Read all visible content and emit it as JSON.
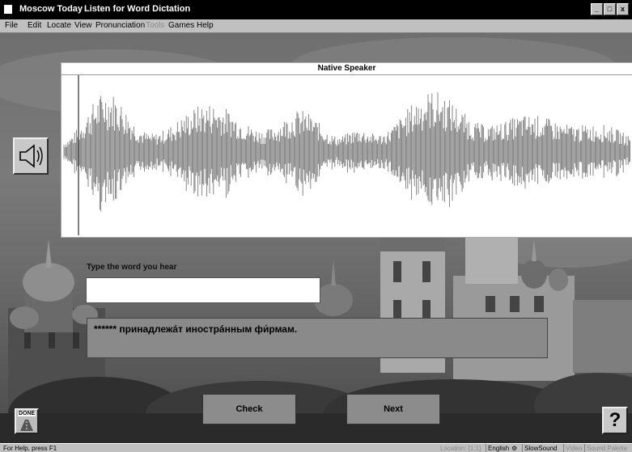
{
  "window": {
    "app_title": "Moscow Today",
    "doc_title": "Listen for Word Dictation",
    "controls": [
      "_",
      "□",
      "x"
    ]
  },
  "menu": [
    "File",
    "Edit",
    "Locate",
    "View",
    "Pronunciation",
    "Tools",
    "Games",
    "Help"
  ],
  "wave_panel": {
    "title": "Native Speaker"
  },
  "speaker_icon": "speaker-icon",
  "prompt": "Type the word you hear",
  "answer": {
    "value": "",
    "placeholder": ""
  },
  "sentence": "****** принадлежáт инострáнным фи́рмам.",
  "buttons": {
    "check": "Check",
    "next": "Next",
    "done": "DONE",
    "help": "?"
  },
  "status": {
    "help_text": "For Help, press F1",
    "location": "Location: [1:1]",
    "language": "English",
    "slow_sound": "SlowSound",
    "video": "Video",
    "sound_palette": "Sound Palette"
  },
  "colors": {
    "titlebar": "#000000",
    "chrome": "#c0c0c0",
    "panel": "#8a8a8a",
    "wave": "#7a7a7a"
  }
}
